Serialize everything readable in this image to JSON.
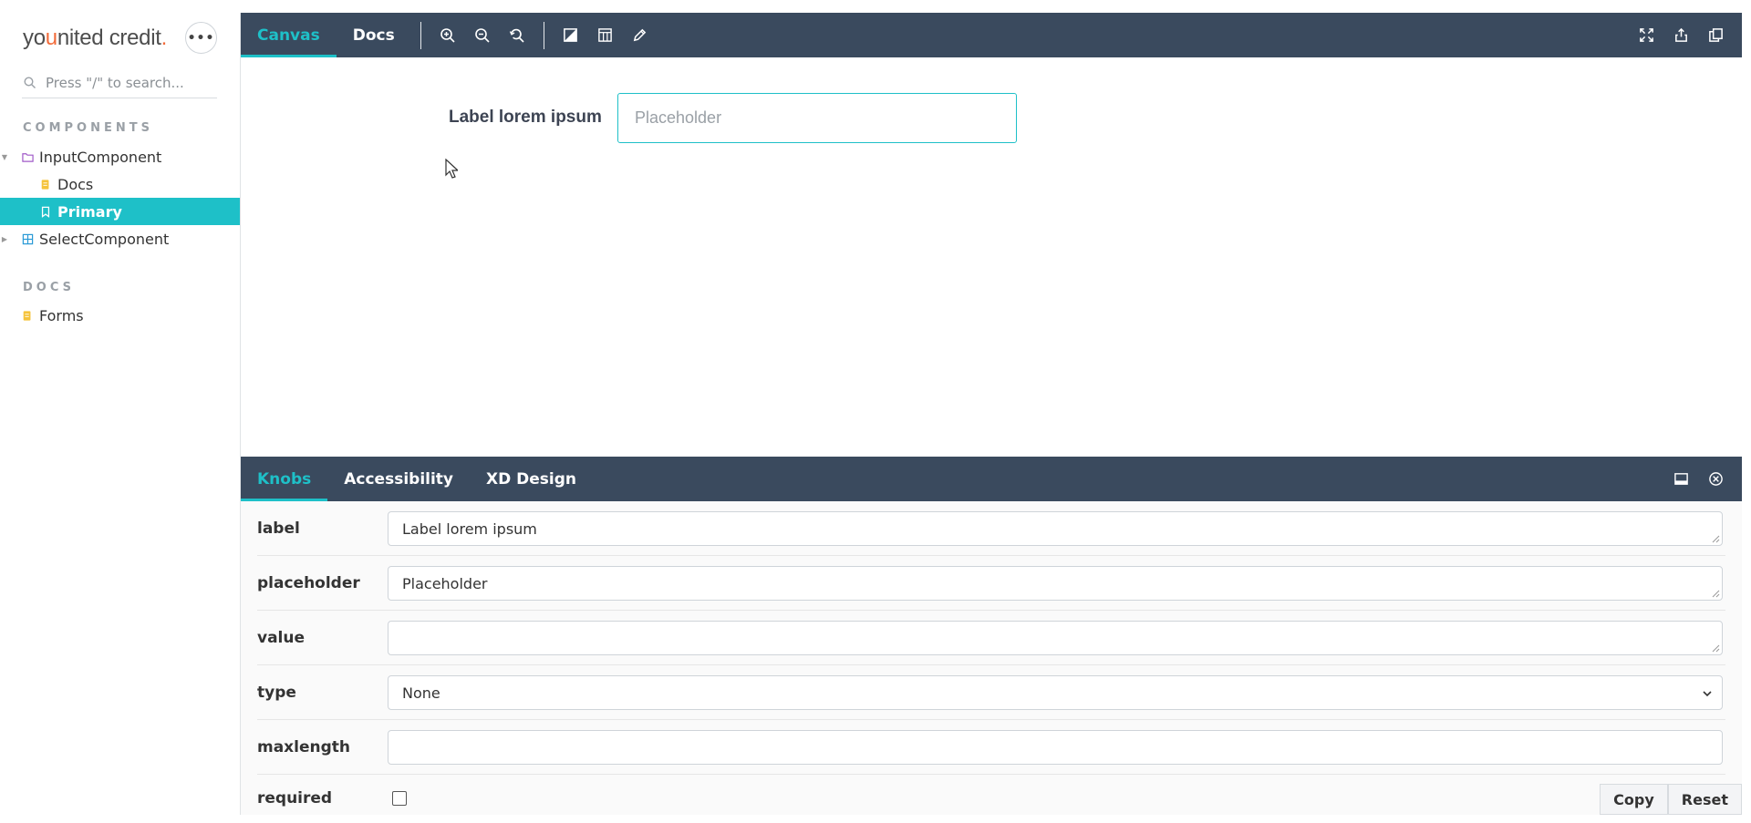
{
  "sidebar": {
    "brand": {
      "part1": "yo",
      "part_u": "u",
      "part2": "nited credit",
      "dot": "."
    },
    "more_button": "•••",
    "search": {
      "placeholder": "Press \"/\" to search..."
    },
    "sections": [
      {
        "title": "COMPONENTS",
        "items": [
          {
            "label": "InputComponent",
            "icon": "folder-icon"
          },
          {
            "label": "Docs",
            "icon": "document-icon"
          },
          {
            "label": "Primary",
            "icon": "bookmark-icon",
            "selected": true
          },
          {
            "label": "SelectComponent",
            "icon": "component-icon"
          }
        ]
      },
      {
        "title": "DOCS",
        "items": [
          {
            "label": "Forms",
            "icon": "document-icon"
          }
        ]
      }
    ]
  },
  "toolbar": {
    "tabs": [
      {
        "label": "Canvas",
        "active": true
      },
      {
        "label": "Docs",
        "active": false
      }
    ],
    "tools": [
      "zoom-in-icon",
      "zoom-out-icon",
      "zoom-reset-icon",
      "background-icon",
      "grid-icon",
      "measure-icon"
    ],
    "right_tools": [
      "fullscreen-icon",
      "share-icon",
      "copy-link-icon"
    ]
  },
  "preview": {
    "label": "Label lorem ipsum",
    "input_placeholder": "Placeholder"
  },
  "addons": {
    "tabs": [
      {
        "label": "Knobs",
        "active": true
      },
      {
        "label": "Accessibility",
        "active": false
      },
      {
        "label": "XD Design",
        "active": false
      }
    ],
    "right_tools": [
      "panel-orientation-icon",
      "close-panel-icon"
    ],
    "knobs": [
      {
        "name": "label",
        "value": "Label lorem ipsum",
        "kind": "text"
      },
      {
        "name": "placeholder",
        "value": "Placeholder",
        "kind": "text"
      },
      {
        "name": "value",
        "value": "",
        "kind": "text"
      },
      {
        "name": "type",
        "value": "None",
        "kind": "select"
      },
      {
        "name": "maxlength",
        "value": "",
        "kind": "number"
      },
      {
        "name": "required",
        "value": false,
        "kind": "checkbox"
      }
    ],
    "buttons": {
      "copy": "Copy",
      "reset": "Reset"
    }
  },
  "colors": {
    "accent": "#1ec0c8",
    "toolbar_bg": "#3a4a5e",
    "brand_orange": "#f26b3a"
  }
}
